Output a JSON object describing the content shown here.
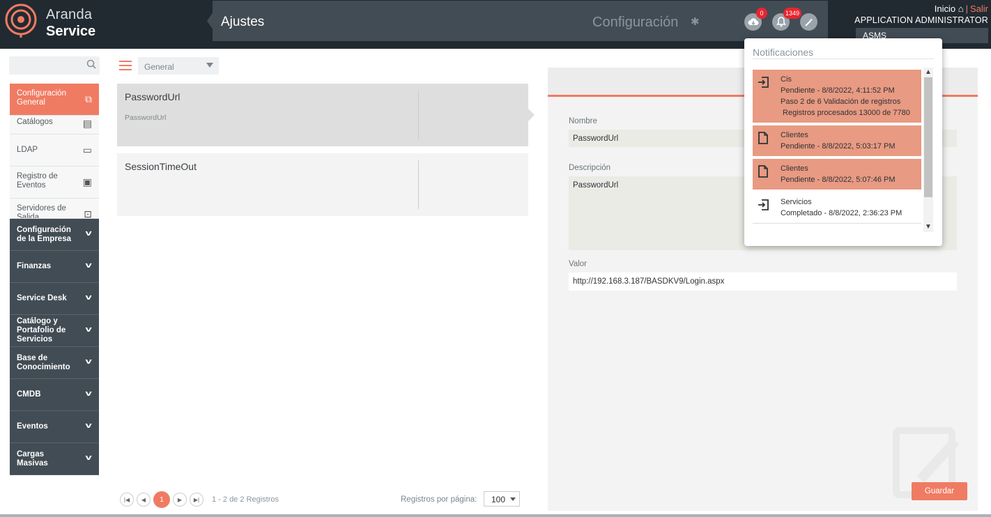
{
  "header": {
    "logo_line1": "Aranda",
    "logo_line2": "Service",
    "page_title": "Ajustes",
    "section_title": "Configuración",
    "cloud_badge": "0",
    "bell_badge": "1349",
    "inicio_label": "Inicio",
    "salir_label": "Salir",
    "user_name": "APPLICATION ADMINISTRATOR",
    "project": "ASMS"
  },
  "sidebar": {
    "items": [
      {
        "label": "Configuración General",
        "icon": "copy-plus-icon"
      },
      {
        "label": "Catálogos",
        "icon": "catalog-icon"
      },
      {
        "label": "LDAP",
        "icon": "folder-user-icon"
      },
      {
        "label": "Registro de Eventos",
        "icon": "clipboard-pulse-icon"
      },
      {
        "label": "Servidores de Salida",
        "icon": "outbox-icon"
      }
    ],
    "groups": [
      {
        "label": "Configuración de la Empresa"
      },
      {
        "label": "Finanzas"
      },
      {
        "label": "Service Desk"
      },
      {
        "label": "Catálogo y Portafolio de Servicios"
      },
      {
        "label": "Base de Conocimiento"
      },
      {
        "label": "CMDB"
      },
      {
        "label": "Eventos"
      },
      {
        "label": "Cargas Masivas"
      }
    ]
  },
  "list": {
    "filter_selected": "General",
    "cards": [
      {
        "name": "PasswordUrl",
        "sub": "PasswordUrl"
      },
      {
        "name": "SessionTimeOut",
        "sub": ""
      }
    ],
    "pager": {
      "current_page": "1",
      "info": "1 - 2 de 2 Registros",
      "per_page_label": "Registros por página:",
      "per_page_value": "100"
    }
  },
  "detail": {
    "nombre_label": "Nombre",
    "nombre_value": "PasswordUrl",
    "descripcion_label": "Descripción",
    "descripcion_value": "PasswordUrl",
    "valor_label": "Valor",
    "valor_value": "http://192.168.3.187/BASDKV9/Login.aspx",
    "save_label": "Guardar"
  },
  "notifications": {
    "title": "Notificaciones",
    "items": [
      {
        "icon": "import-icon",
        "status": "pending",
        "lines": [
          "Cis",
          "Pendiente - 8/8/2022, 4:11:52 PM",
          "Paso 2 de 6 Validación de registros",
          " Registros procesados 13000 de 7780"
        ]
      },
      {
        "icon": "file-icon",
        "status": "pending",
        "lines": [
          "Clientes",
          "Pendiente - 8/8/2022, 5:03:17 PM"
        ]
      },
      {
        "icon": "file-icon",
        "status": "pending",
        "lines": [
          "Clientes",
          "Pendiente - 8/8/2022, 5:07:46 PM"
        ]
      },
      {
        "icon": "import-icon",
        "status": "done",
        "lines": [
          "Servicios",
          "Completado - 8/8/2022, 2:36:23 PM"
        ]
      }
    ]
  },
  "colors": {
    "accent": "#f07b63",
    "dark": "#212a31",
    "panel": "#424c54",
    "badge": "#e8252f"
  }
}
